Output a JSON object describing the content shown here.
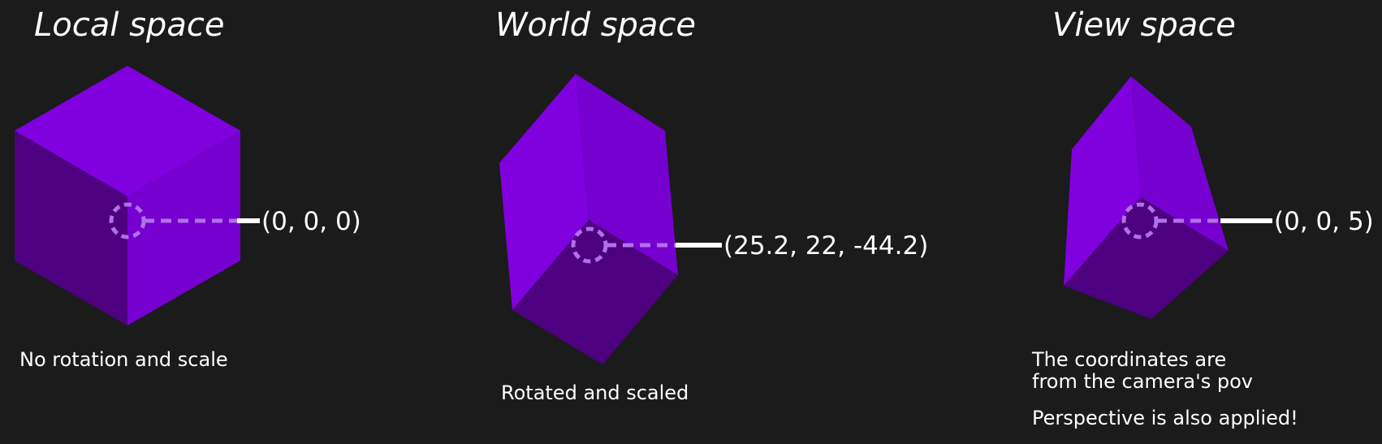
{
  "colors": {
    "background": "#1b1b1b",
    "face_light": "#8000e0",
    "face_mid": "#7500cf",
    "face_dark": "#4d007f",
    "marker": "#b070e8",
    "text": "#ffffff"
  },
  "panels": [
    {
      "title": "Local space",
      "coordinate": "(0, 0, 0)",
      "captions": [
        "No rotation and scale"
      ]
    },
    {
      "title": "World space",
      "coordinate": "(25.2, 22, -44.2)",
      "captions": [
        "Rotated and scaled"
      ]
    },
    {
      "title": "View space",
      "coordinate": "(0, 0, 5)",
      "captions": [
        "The coordinates are",
        "from the camera's pov",
        "Perspective is also applied!"
      ]
    }
  ]
}
